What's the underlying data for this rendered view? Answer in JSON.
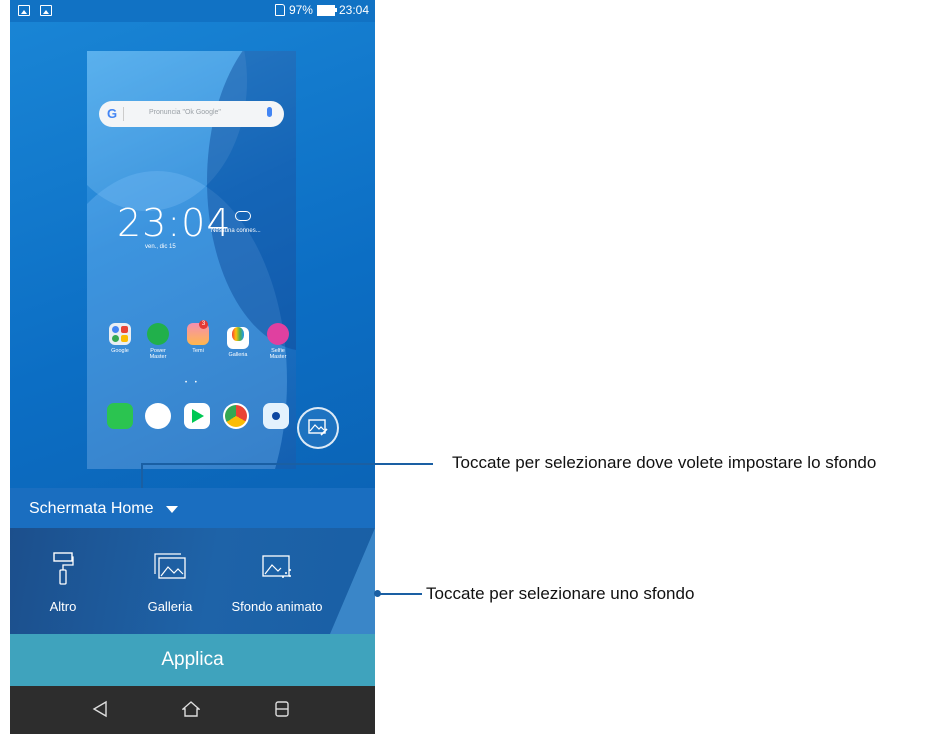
{
  "status_bar": {
    "battery": "97%",
    "time": "23:04"
  },
  "preview": {
    "search_placeholder": "Pronuncia \"Ok Google\"",
    "clock": "23:04",
    "weather": "Nessuna connes...",
    "date": "ven., dic 15",
    "apps": [
      {
        "label": "Google"
      },
      {
        "label": "Power Master"
      },
      {
        "label": "Temi",
        "badge": "3"
      },
      {
        "label": "Galleria"
      },
      {
        "label": "Selfie Master"
      }
    ]
  },
  "target_selector": {
    "label": "Schermata Home"
  },
  "options": [
    {
      "label": "Altro",
      "icon": "paint-roller-icon"
    },
    {
      "label": "Galleria",
      "icon": "gallery-icon"
    },
    {
      "label": "Sfondo animato",
      "icon": "live-wallpaper-icon"
    }
  ],
  "apply_label": "Applica",
  "callouts": {
    "target": "Toccate per selezionare dove volete impostare lo sfondo",
    "wallpaper": "Toccate per selezionare uno sfondo"
  },
  "colors": {
    "accent": "#3fa3bd",
    "panel": "#1a6ec0",
    "nav": "#2d2d2d"
  }
}
